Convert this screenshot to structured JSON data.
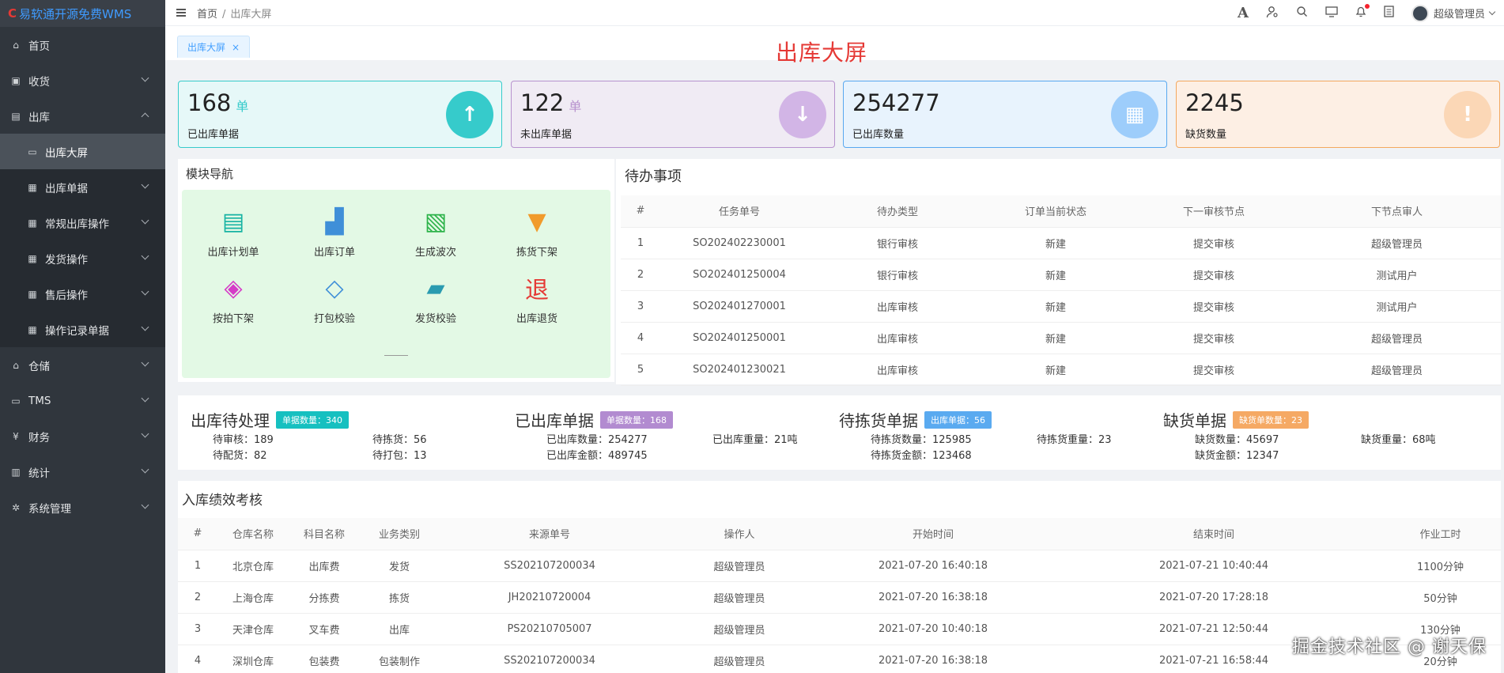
{
  "app": {
    "logo_mark": "C",
    "logo_text": "易软通开源免费WMS"
  },
  "sidebar": {
    "items": [
      {
        "label": "首页",
        "icon": "home-icon",
        "glyph": "⌂"
      },
      {
        "label": "收货",
        "icon": "receive-icon",
        "glyph": "▣"
      },
      {
        "label": "出库",
        "icon": "outbound-icon",
        "glyph": "▤"
      },
      {
        "label": "出库大屏",
        "icon": "screen-icon",
        "glyph": "▭"
      },
      {
        "label": "出库单据",
        "icon": "doc-icon",
        "glyph": "▦"
      },
      {
        "label": "常规出库操作",
        "icon": "doc-icon",
        "glyph": "▦"
      },
      {
        "label": "发货操作",
        "icon": "doc-icon",
        "glyph": "▦"
      },
      {
        "label": "售后操作",
        "icon": "doc-icon",
        "glyph": "▦"
      },
      {
        "label": "操作记录单据",
        "icon": "doc-icon",
        "glyph": "▦"
      },
      {
        "label": "仓储",
        "icon": "warehouse-icon",
        "glyph": "⌂"
      },
      {
        "label": "TMS",
        "icon": "truck-icon",
        "glyph": "▭"
      },
      {
        "label": "财务",
        "icon": "finance-icon",
        "glyph": "¥"
      },
      {
        "label": "统计",
        "icon": "stats-icon",
        "glyph": "▥"
      },
      {
        "label": "系统管理",
        "icon": "settings-icon",
        "glyph": "✲"
      }
    ]
  },
  "topbar": {
    "home": "首页",
    "separator": "/",
    "current": "出库大屏",
    "font_icon": "A",
    "username": "超级管理员"
  },
  "tabs": {
    "active": "出库大屏",
    "close": "×"
  },
  "page_title": "出库大屏",
  "cards": [
    {
      "value": "168",
      "unit": "单",
      "label": "已出库单据",
      "bg": "#e6f8f8",
      "border": "#36cbcb",
      "circle": "#36cbcb",
      "unit_color": "#36cbcb",
      "icon": "up-arrow-icon",
      "glyph": "↑"
    },
    {
      "value": "122",
      "unit": "单",
      "label": "未出库单据",
      "bg": "#f0ebf4",
      "border": "#b792ce",
      "circle": "#d2b5e6",
      "unit_color": "#b792ce",
      "icon": "down-arrow-icon",
      "glyph": "↓"
    },
    {
      "value": "254277",
      "unit": "",
      "label": "已出库数量",
      "bg": "#e8f3fd",
      "border": "#58a8f0",
      "circle": "#9dcdfb",
      "unit_color": "#58a8f0",
      "icon": "calendar-icon",
      "glyph": "▦"
    },
    {
      "value": "2245",
      "unit": "",
      "label": "缺货数量",
      "bg": "#fdefe4",
      "border": "#f3a85e",
      "circle": "#fbd7b6",
      "unit_color": "#f3a85e",
      "icon": "alert-icon",
      "glyph": "!"
    }
  ],
  "module_nav": {
    "title": "模块导航",
    "items": [
      {
        "label": "出库计划单",
        "icon": "clipboard-icon",
        "glyph": "▤",
        "color": "#17b3a3"
      },
      {
        "label": "出库订单",
        "icon": "forklift-icon",
        "glyph": "▟",
        "color": "#3f8fd8"
      },
      {
        "label": "生成波次",
        "icon": "checklist-icon",
        "glyph": "▧",
        "color": "#2db34a"
      },
      {
        "label": "拣货下架",
        "icon": "cart-icon",
        "glyph": "▼",
        "color": "#f19b2c"
      },
      {
        "label": "按拍下架",
        "icon": "boxes-icon",
        "glyph": "◈",
        "color": "#d53bc7"
      },
      {
        "label": "打包校验",
        "icon": "package-icon",
        "glyph": "◇",
        "color": "#3f8fd8"
      },
      {
        "label": "发货校验",
        "icon": "truck-icon",
        "glyph": "▰",
        "color": "#2a9bb0"
      },
      {
        "label": "出库退货",
        "icon": "return-icon",
        "glyph": "退",
        "color": "#e53935"
      }
    ]
  },
  "todo": {
    "title": "待办事项",
    "headers": [
      "#",
      "任务单号",
      "待办类型",
      "订单当前状态",
      "下一审核节点",
      "下节点审人"
    ],
    "rows": [
      [
        "1",
        "SO202402230001",
        "银行审核",
        "新建",
        "提交审核",
        "超级管理员"
      ],
      [
        "2",
        "SO202401250004",
        "银行审核",
        "新建",
        "提交审核",
        "测试用户"
      ],
      [
        "3",
        "SO202401270001",
        "出库审核",
        "新建",
        "提交审核",
        "测试用户"
      ],
      [
        "4",
        "SO202401250001",
        "出库审核",
        "新建",
        "提交审核",
        "超级管理员"
      ],
      [
        "5",
        "SO202401230021",
        "出库审核",
        "新建",
        "提交审核",
        "超级管理员"
      ]
    ]
  },
  "stats": [
    {
      "title": "出库待处理",
      "badge": "单据数量：340",
      "badge_color": "#16c0c0",
      "rows": [
        [
          "待审核：",
          "189"
        ],
        [
          "待配货：",
          "82"
        ],
        [
          "待拣货：",
          "56"
        ],
        [
          "待打包：",
          "13"
        ]
      ]
    },
    {
      "title": "已出库单据",
      "badge": "单据数量：168",
      "badge_color": "#b28bd0",
      "rows": [
        [
          "已出库数量：",
          "254277"
        ],
        [
          "已出库金额：",
          "489745"
        ],
        [
          "已出库重量：",
          "21吨"
        ]
      ]
    },
    {
      "title": "待拣货单据",
      "badge": "出库单据：56",
      "badge_color": "#5aaaf0",
      "rows": [
        [
          "待拣货数量：",
          "125985"
        ],
        [
          "待拣货金额：",
          "123468"
        ],
        [
          "待拣货重量：",
          "23"
        ]
      ]
    },
    {
      "title": "缺货单据",
      "badge": "缺货单数量：23",
      "badge_color": "#f5a964",
      "rows": [
        [
          "缺货数量：",
          "45697"
        ],
        [
          "缺货金额：",
          "12347"
        ],
        [
          "缺货重量：",
          "68吨"
        ]
      ]
    }
  ],
  "perf": {
    "title": "入库绩效考核",
    "headers": [
      "#",
      "仓库名称",
      "科目名称",
      "业务类别",
      "来源单号",
      "操作人",
      "开始时间",
      "结束时间",
      "作业工时"
    ],
    "rows": [
      [
        "1",
        "北京仓库",
        "出库费",
        "发货",
        "SS202107200034",
        "超级管理员",
        "2021-07-20 16:40:18",
        "2021-07-21 10:40:44",
        "1100分钟"
      ],
      [
        "2",
        "上海仓库",
        "分拣费",
        "拣货",
        "JH20210720004",
        "超级管理员",
        "2021-07-20 16:38:18",
        "2021-07-20 17:28:18",
        "50分钟"
      ],
      [
        "3",
        "天津仓库",
        "叉车费",
        "出库",
        "PS20210705007",
        "超级管理员",
        "2021-07-20 10:40:18",
        "2021-07-21 12:50:44",
        "130分钟"
      ],
      [
        "4",
        "深圳仓库",
        "包装费",
        "包装制作",
        "SS202107200034",
        "超级管理员",
        "2021-07-20 16:38:18",
        "2021-07-21 16:58:44",
        "20分钟"
      ]
    ]
  },
  "watermark": "掘金技术社区 @ 谢天保"
}
